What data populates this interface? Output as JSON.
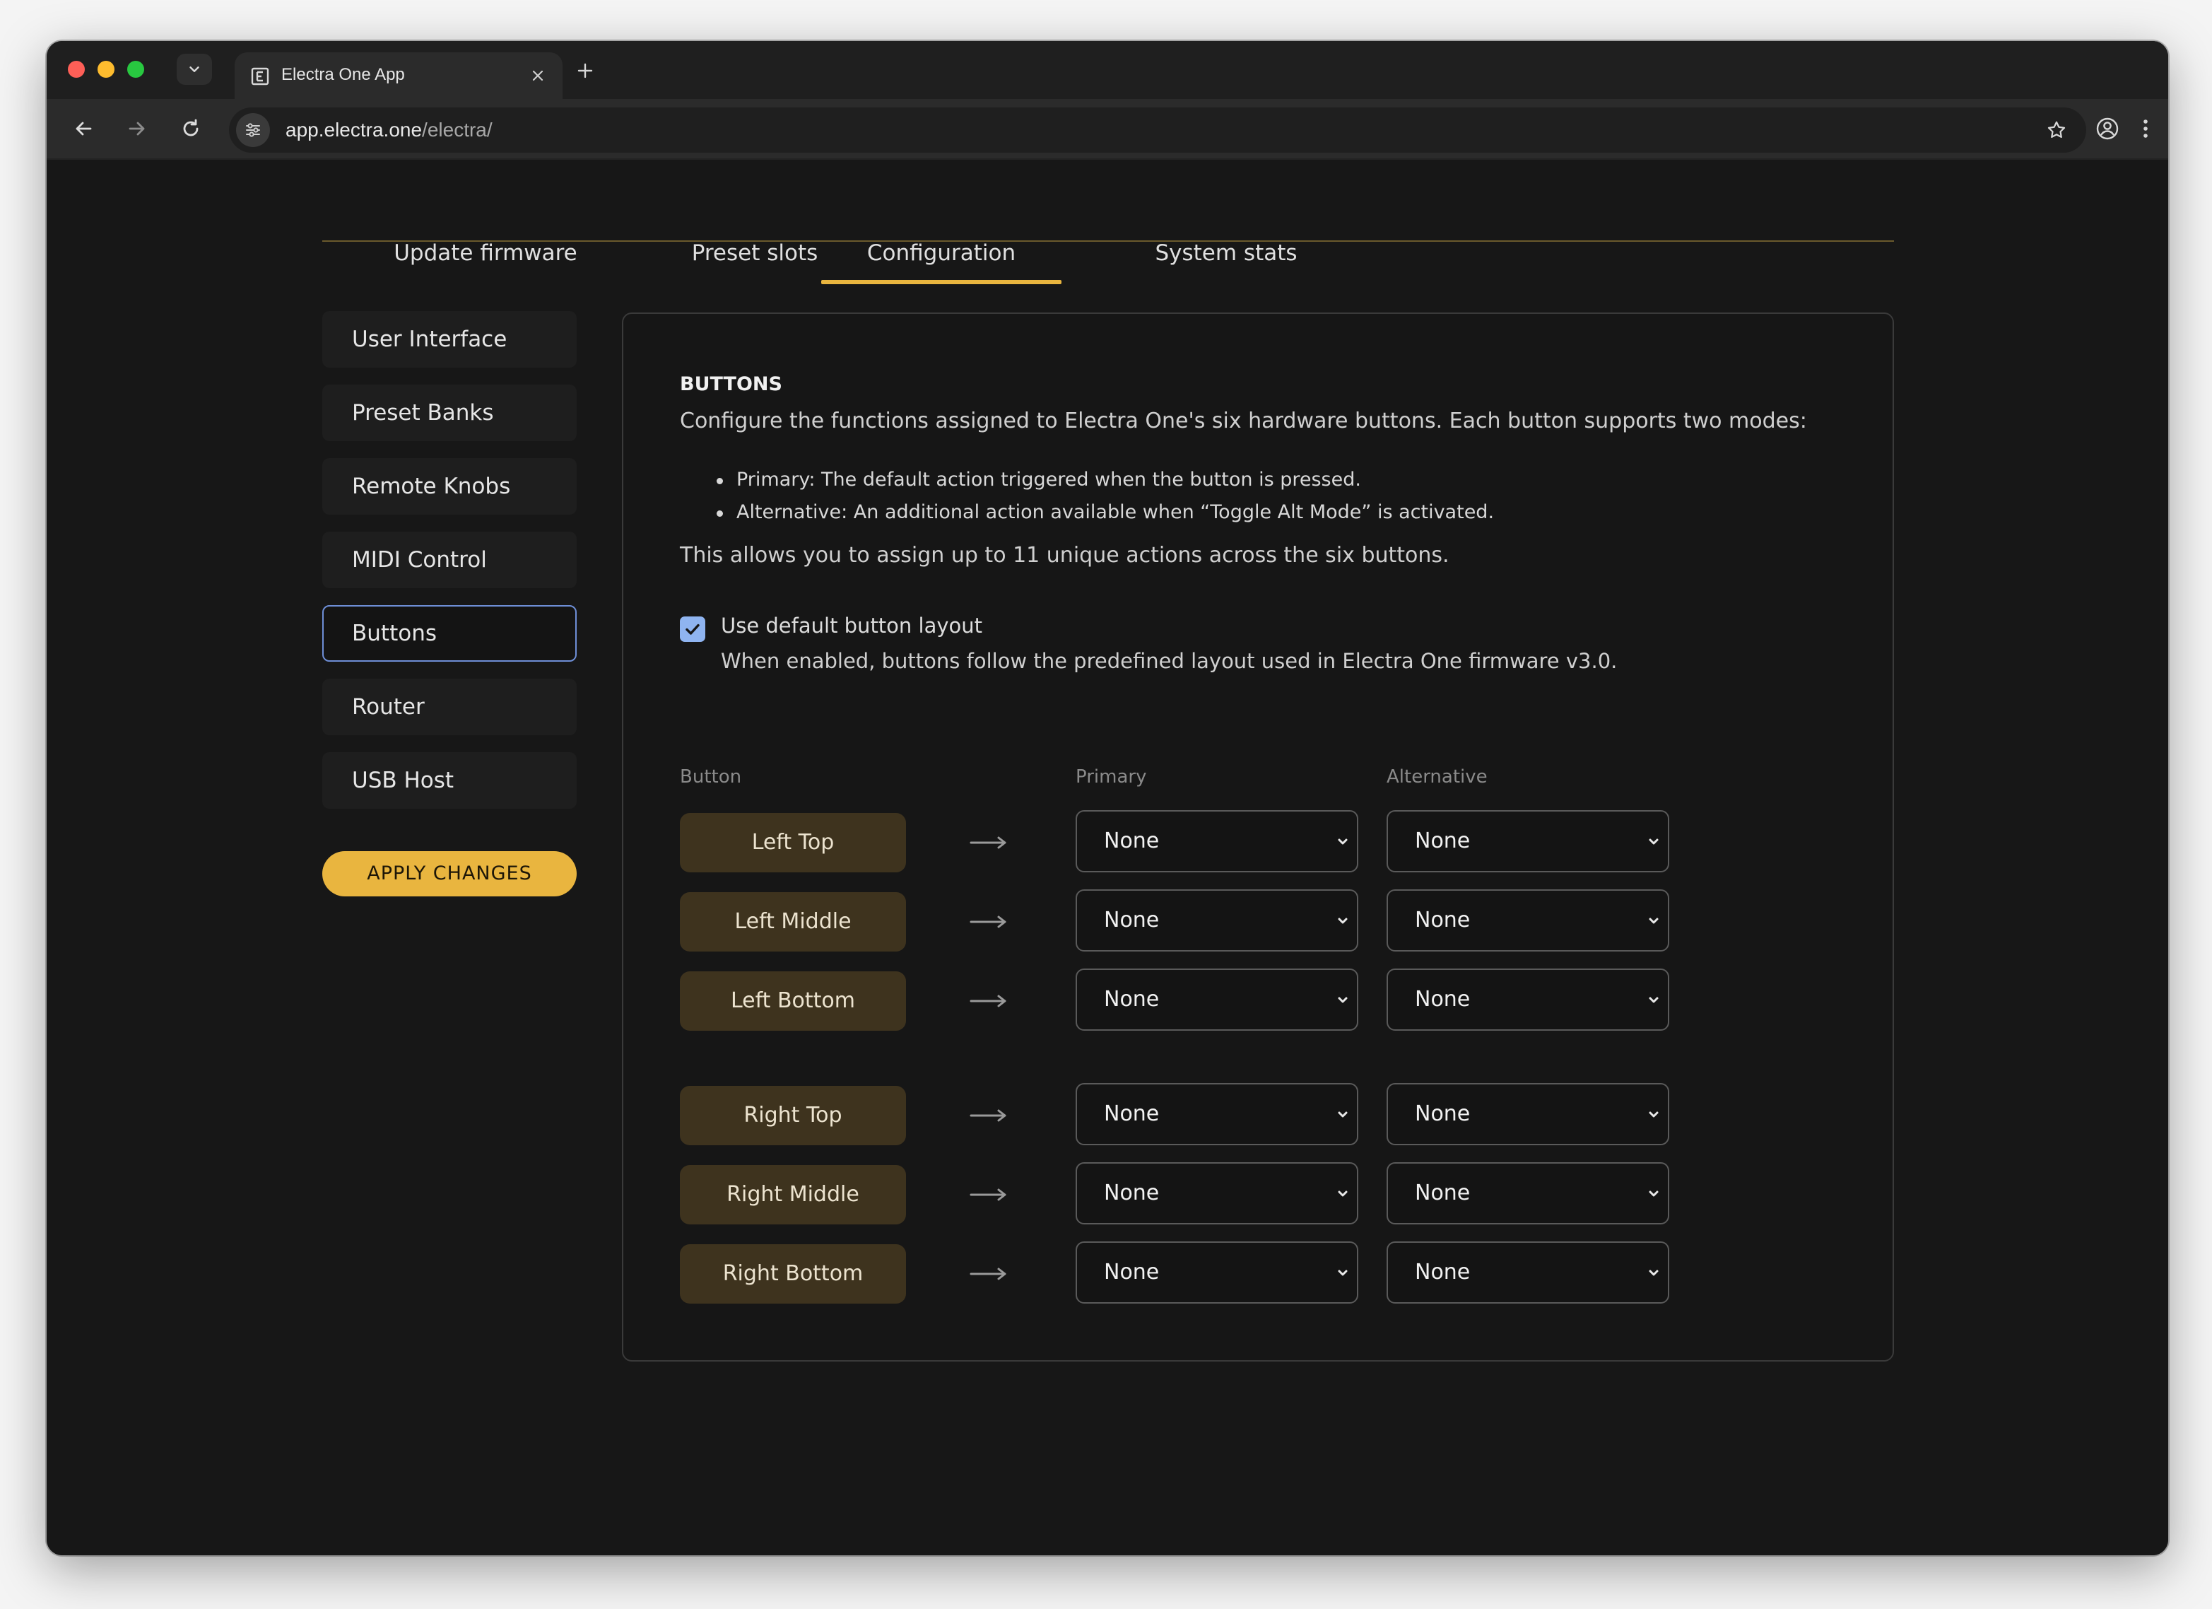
{
  "browser": {
    "tab_title": "Electra One App",
    "url_host": "app.electra.one",
    "url_path": "/electra/"
  },
  "main_tabs": [
    {
      "label": "Update firmware"
    },
    {
      "label": "Preset slots"
    },
    {
      "label": "Configuration",
      "active": true
    },
    {
      "label": "System stats"
    }
  ],
  "sidebar": {
    "items": [
      {
        "label": "User Interface"
      },
      {
        "label": "Preset Banks"
      },
      {
        "label": "Remote Knobs"
      },
      {
        "label": "MIDI Control"
      },
      {
        "label": "Buttons",
        "active": true
      },
      {
        "label": "Router"
      },
      {
        "label": "USB Host"
      }
    ],
    "apply_label": "APPLY CHANGES"
  },
  "panel": {
    "title": "BUTTONS",
    "description": "Configure the functions assigned to Electra One's six hardware buttons. Each button supports two modes:",
    "bullets": [
      "Primary: The default action triggered when the button is pressed.",
      "Alternative: An additional action available when “Toggle Alt Mode” is activated."
    ],
    "summary": "This allows you to assign up to 11 unique actions across the six buttons.",
    "checkbox": {
      "checked": true,
      "label": "Use default button layout",
      "help": "When enabled, buttons follow the predefined layout used in Electra One firmware v3.0."
    },
    "columns": {
      "button": "Button",
      "primary": "Primary",
      "alternative": "Alternative"
    },
    "rows": [
      {
        "button": "Left Top",
        "primary": "None",
        "alternative": "None"
      },
      {
        "button": "Left Middle",
        "primary": "None",
        "alternative": "None"
      },
      {
        "button": "Left Bottom",
        "primary": "None",
        "alternative": "None"
      },
      {
        "button": "Right Top",
        "primary": "None",
        "alternative": "None"
      },
      {
        "button": "Right Middle",
        "primary": "None",
        "alternative": "None"
      },
      {
        "button": "Right Bottom",
        "primary": "None",
        "alternative": "None"
      }
    ]
  },
  "colors": {
    "accent": "#e9b53f",
    "hw_button_bg": "#3e331e",
    "active_outline": "#6e8ed6",
    "checkbox": "#8fb4f0"
  }
}
